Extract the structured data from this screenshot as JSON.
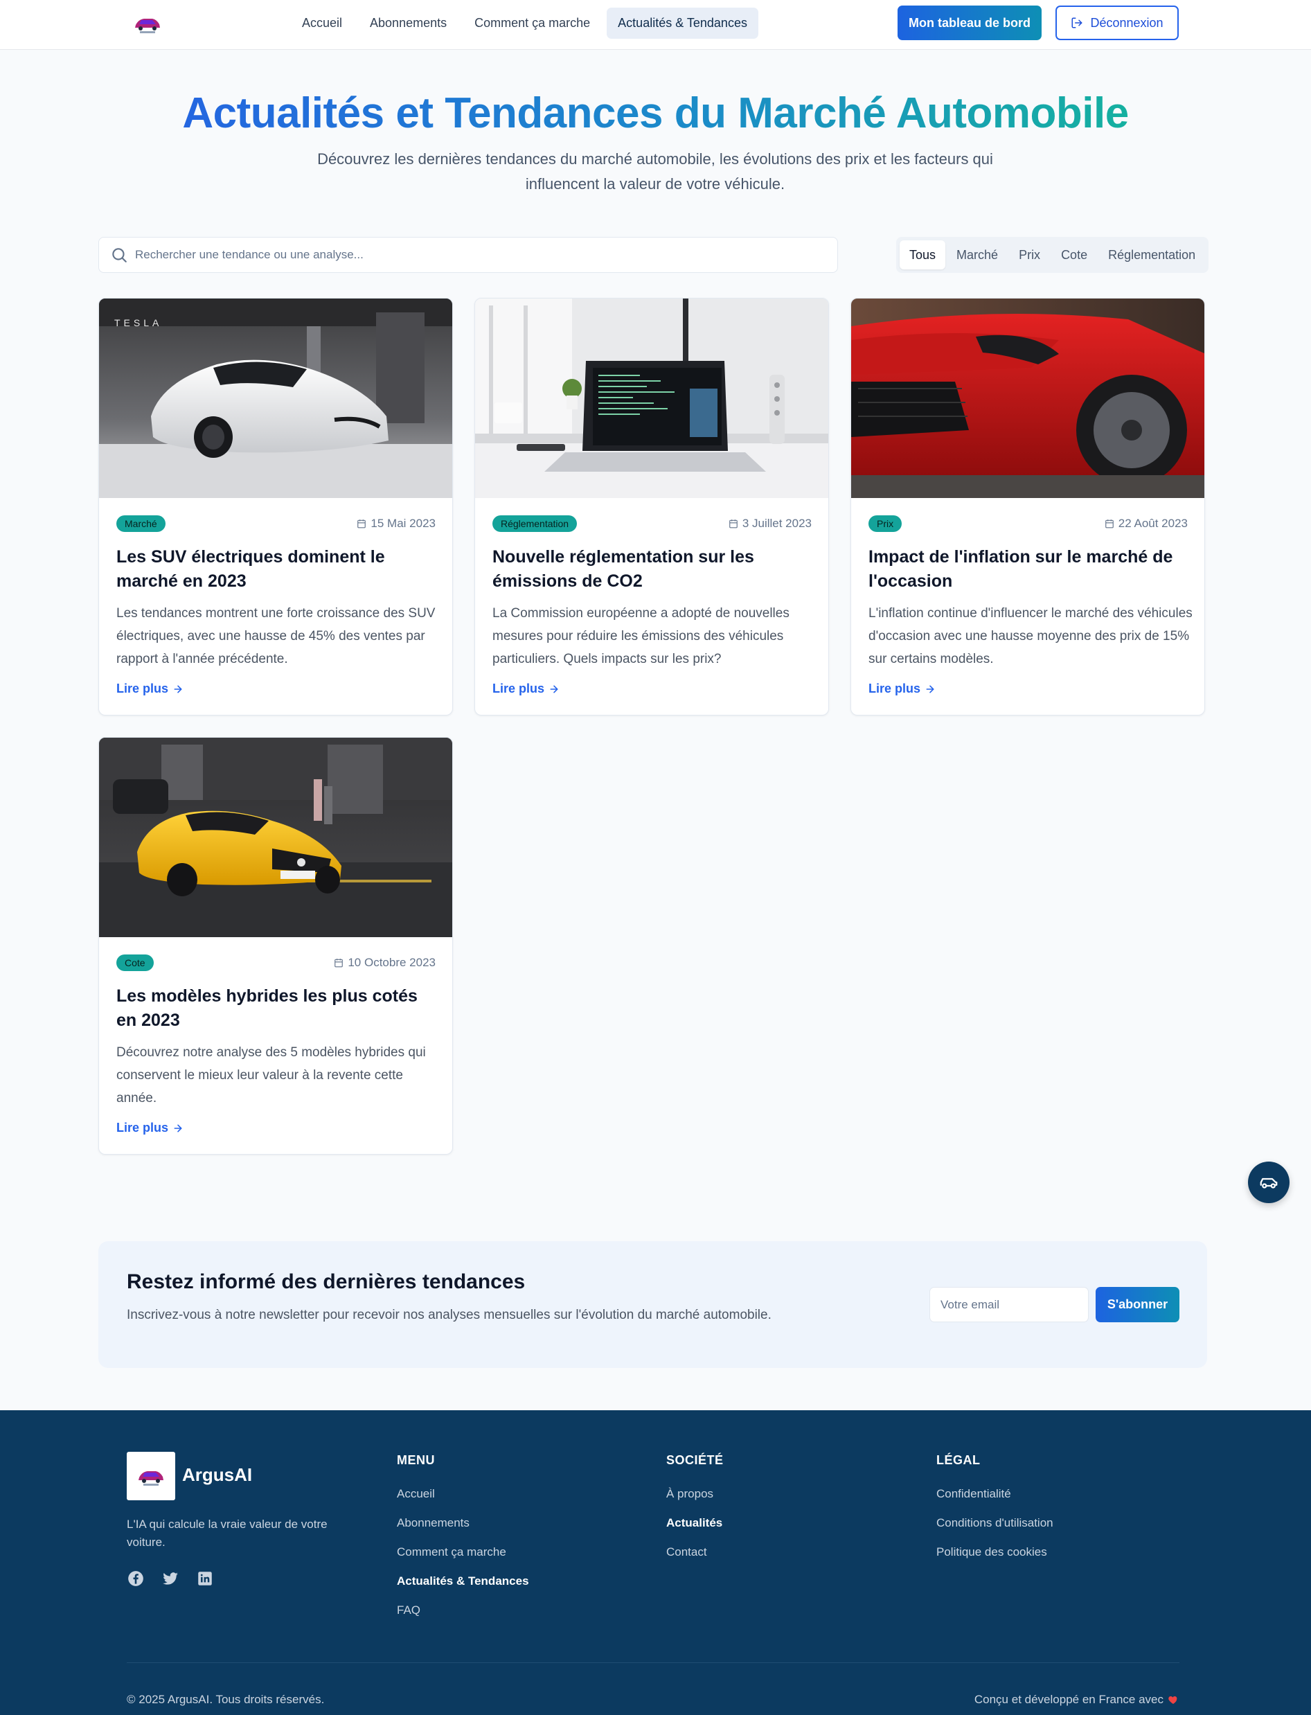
{
  "nav": {
    "items": [
      {
        "label": "Accueil"
      },
      {
        "label": "Abonnements"
      },
      {
        "label": "Comment ça marche"
      },
      {
        "label": "Actualités & Tendances",
        "active": true
      }
    ],
    "dashboard_label": "Mon tableau de bord",
    "logout_label": "Déconnexion",
    "logout_icon": "logout-icon"
  },
  "hero": {
    "title": "Actualités et Tendances du Marché Automobile",
    "subtitle": "Découvrez les dernières tendances du marché automobile, les évolutions des prix et les facteurs qui influencent la valeur de votre véhicule."
  },
  "search": {
    "placeholder": "Rechercher une tendance ou une analyse...",
    "icon": "search-icon"
  },
  "filters": [
    {
      "label": "Tous",
      "active": true
    },
    {
      "label": "Marché"
    },
    {
      "label": "Prix"
    },
    {
      "label": "Cote"
    },
    {
      "label": "Réglementation"
    }
  ],
  "articles": [
    {
      "category": "Marché",
      "date": "15 Mai 2023",
      "title": "Les SUV électriques dominent le marché en 2023",
      "excerpt": "Les tendances montrent une forte croissance des SUV électriques, avec une hausse de 45% des ventes par rapport à l'année précédente.",
      "read_more": "Lire plus",
      "image": "white-sports-car-photo",
      "image_text": "TESLA"
    },
    {
      "category": "Réglementation",
      "date": "3 Juillet 2023",
      "title": "Nouvelle réglementation sur les émissions de CO2",
      "excerpt": "La Commission européenne a adopté de nouvelles mesures pour réduire les émissions des véhicules particuliers. Quels impacts sur les prix?",
      "read_more": "Lire plus",
      "image": "laptop-desk-photo"
    },
    {
      "category": "Prix",
      "date": "22 Août 2023",
      "title": "Impact de l'inflation sur le marché de l'occasion",
      "excerpt": "L'inflation continue d'influencer le marché des véhicules d'occasion avec une hausse moyenne des prix de 15% sur certains modèles.",
      "read_more": "Lire plus",
      "image": "red-car-front-photo"
    },
    {
      "category": "Cote",
      "date": "10 Octobre 2023",
      "title": "Les modèles hybrides les plus cotés en 2023",
      "excerpt": "Découvrez notre analyse des 5 modèles hybrides qui conservent le mieux leur valeur à la revente cette année.",
      "read_more": "Lire plus",
      "image": "yellow-sports-car-street-photo"
    }
  ],
  "newsletter": {
    "title": "Restez informé des dernières tendances",
    "text": "Inscrivez-vous à notre newsletter pour recevoir nos analyses mensuelles sur l'évolution du marché automobile.",
    "email_placeholder": "Votre email",
    "button": "S'abonner"
  },
  "footer": {
    "brand": "ArgusAI",
    "tagline": "L'IA qui calcule la vraie valeur de votre voiture.",
    "social": [
      "facebook-icon",
      "twitter-icon",
      "linkedin-icon"
    ],
    "columns": [
      {
        "title": "MENU",
        "links": [
          {
            "label": "Accueil"
          },
          {
            "label": "Abonnements"
          },
          {
            "label": "Comment ça marche"
          },
          {
            "label": "Actualités & Tendances",
            "bold": true
          },
          {
            "label": "FAQ"
          }
        ]
      },
      {
        "title": "SOCIÉTÉ",
        "links": [
          {
            "label": "À propos"
          },
          {
            "label": "Actualités",
            "bold": true
          },
          {
            "label": "Contact"
          }
        ]
      },
      {
        "title": "LÉGAL",
        "links": [
          {
            "label": "Confidentialité"
          },
          {
            "label": "Conditions d'utilisation"
          },
          {
            "label": "Politique des cookies"
          }
        ]
      }
    ],
    "copyright": "© 2025 ArgusAI. Tous droits réservés.",
    "made_in": "Conçu et développé en France avec"
  },
  "colors": {
    "primary": "#2563eb",
    "accent_teal": "#14a39a",
    "footer_bg": "#0c3a60",
    "heart": "#ef4444"
  }
}
